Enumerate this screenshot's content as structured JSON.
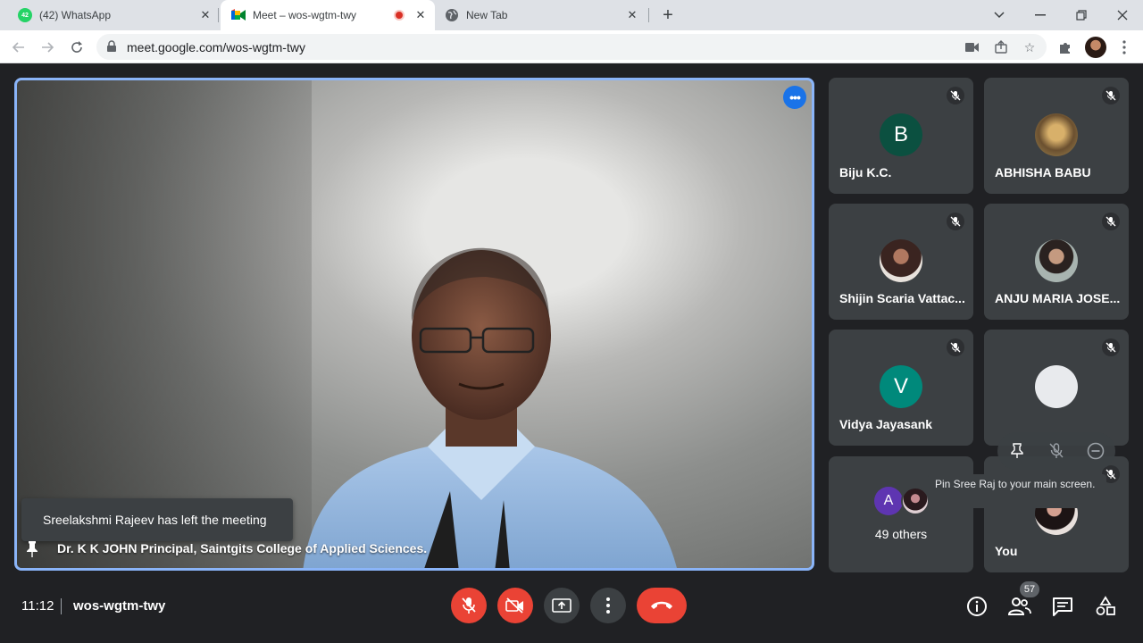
{
  "tabs": [
    {
      "title": "(42) WhatsApp",
      "badge": "42"
    },
    {
      "title": "Meet – wos-wgtm-twy"
    },
    {
      "title": "New Tab"
    }
  ],
  "address_bar": {
    "url": "meet.google.com/wos-wgtm-twy"
  },
  "main_video": {
    "speaker_name": "Dr. K K JOHN Principal, Saintgits College of Applied Sciences.",
    "toast": "Sreelakshmi Rajeev has left the meeting"
  },
  "participants": [
    {
      "name": "Biju K.C.",
      "initial": "B",
      "avatar_color": "#0b5040"
    },
    {
      "name": "ABHISHA BABU"
    },
    {
      "name": "Shijin Scaria Vattac..."
    },
    {
      "name": "ANJU MARIA JOSE..."
    },
    {
      "name": "Vidya Jayasank",
      "initial": "V",
      "avatar_color": "#00897b"
    },
    {
      "name": "Sree Raj"
    },
    {
      "others_label": "49 others",
      "others_initial": "A",
      "others_color": "#5e35b1"
    },
    {
      "name": "You"
    }
  ],
  "tooltip": "Pin Sree Raj to your main screen.",
  "bottom_bar": {
    "time": "11:12",
    "meeting_code": "wos-wgtm-twy",
    "participant_count": "57"
  },
  "colors": {
    "accent": "#8ab4f8",
    "danger": "#ea4335",
    "tile_bg": "#3c4043",
    "background": "#202124"
  }
}
